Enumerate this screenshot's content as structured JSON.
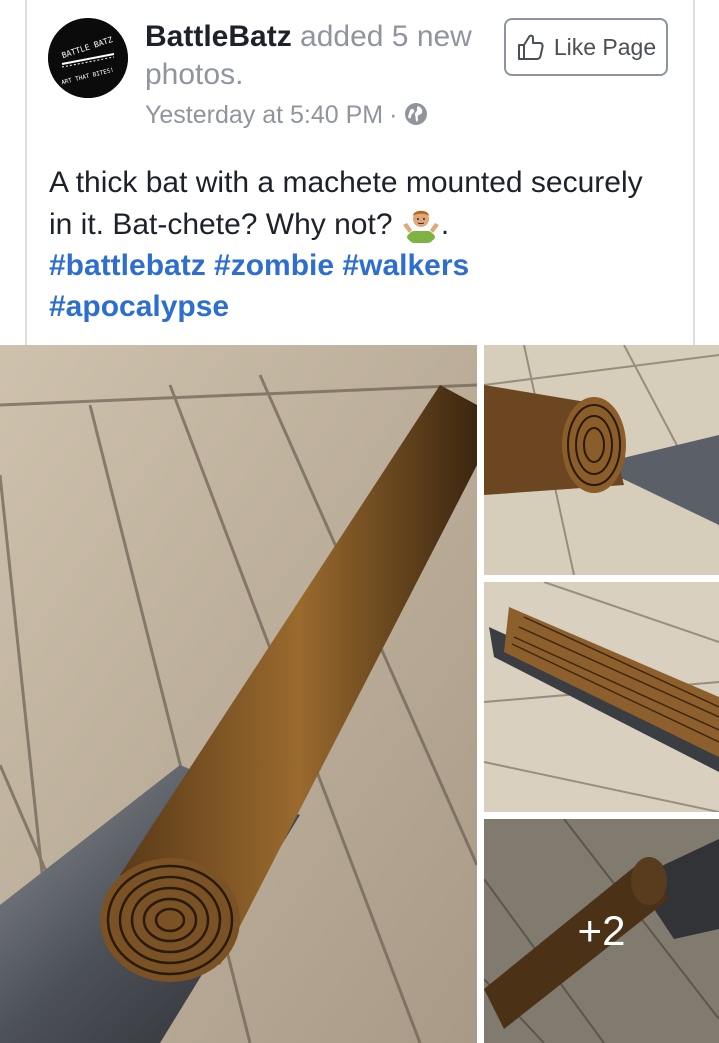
{
  "post": {
    "page_name": "BattleBatz",
    "action_text": " added 5 new photos.",
    "timestamp": "Yesterday at 5:40 PM",
    "separator": "·",
    "privacy_icon": "globe-icon",
    "avatar": {
      "text_top": "BATTLE BATZ",
      "text_bottom": "ART THAT BITES!"
    },
    "like_button": {
      "label": "Like Page",
      "icon": "thumbs-up-icon"
    },
    "body_text": "A thick bat with a machete mounted securely in it. Bat-chete? Why not?",
    "body_text_end": ".",
    "emoji": "person-shrugging-emoji",
    "hashtags": [
      "#battlebatz",
      "#zombie",
      "#walkers",
      "#apocalypse"
    ]
  },
  "photos": {
    "more_count": "+2",
    "items": [
      {
        "name": "photo-main-bat-machete"
      },
      {
        "name": "photo-bat-end-closeup"
      },
      {
        "name": "photo-bat-side-blade"
      },
      {
        "name": "photo-bat-diagonal"
      }
    ]
  },
  "colors": {
    "hashtag": "#2d6ed0",
    "text": "#1d2129",
    "muted": "#90949c",
    "border": "#dcdde1"
  }
}
